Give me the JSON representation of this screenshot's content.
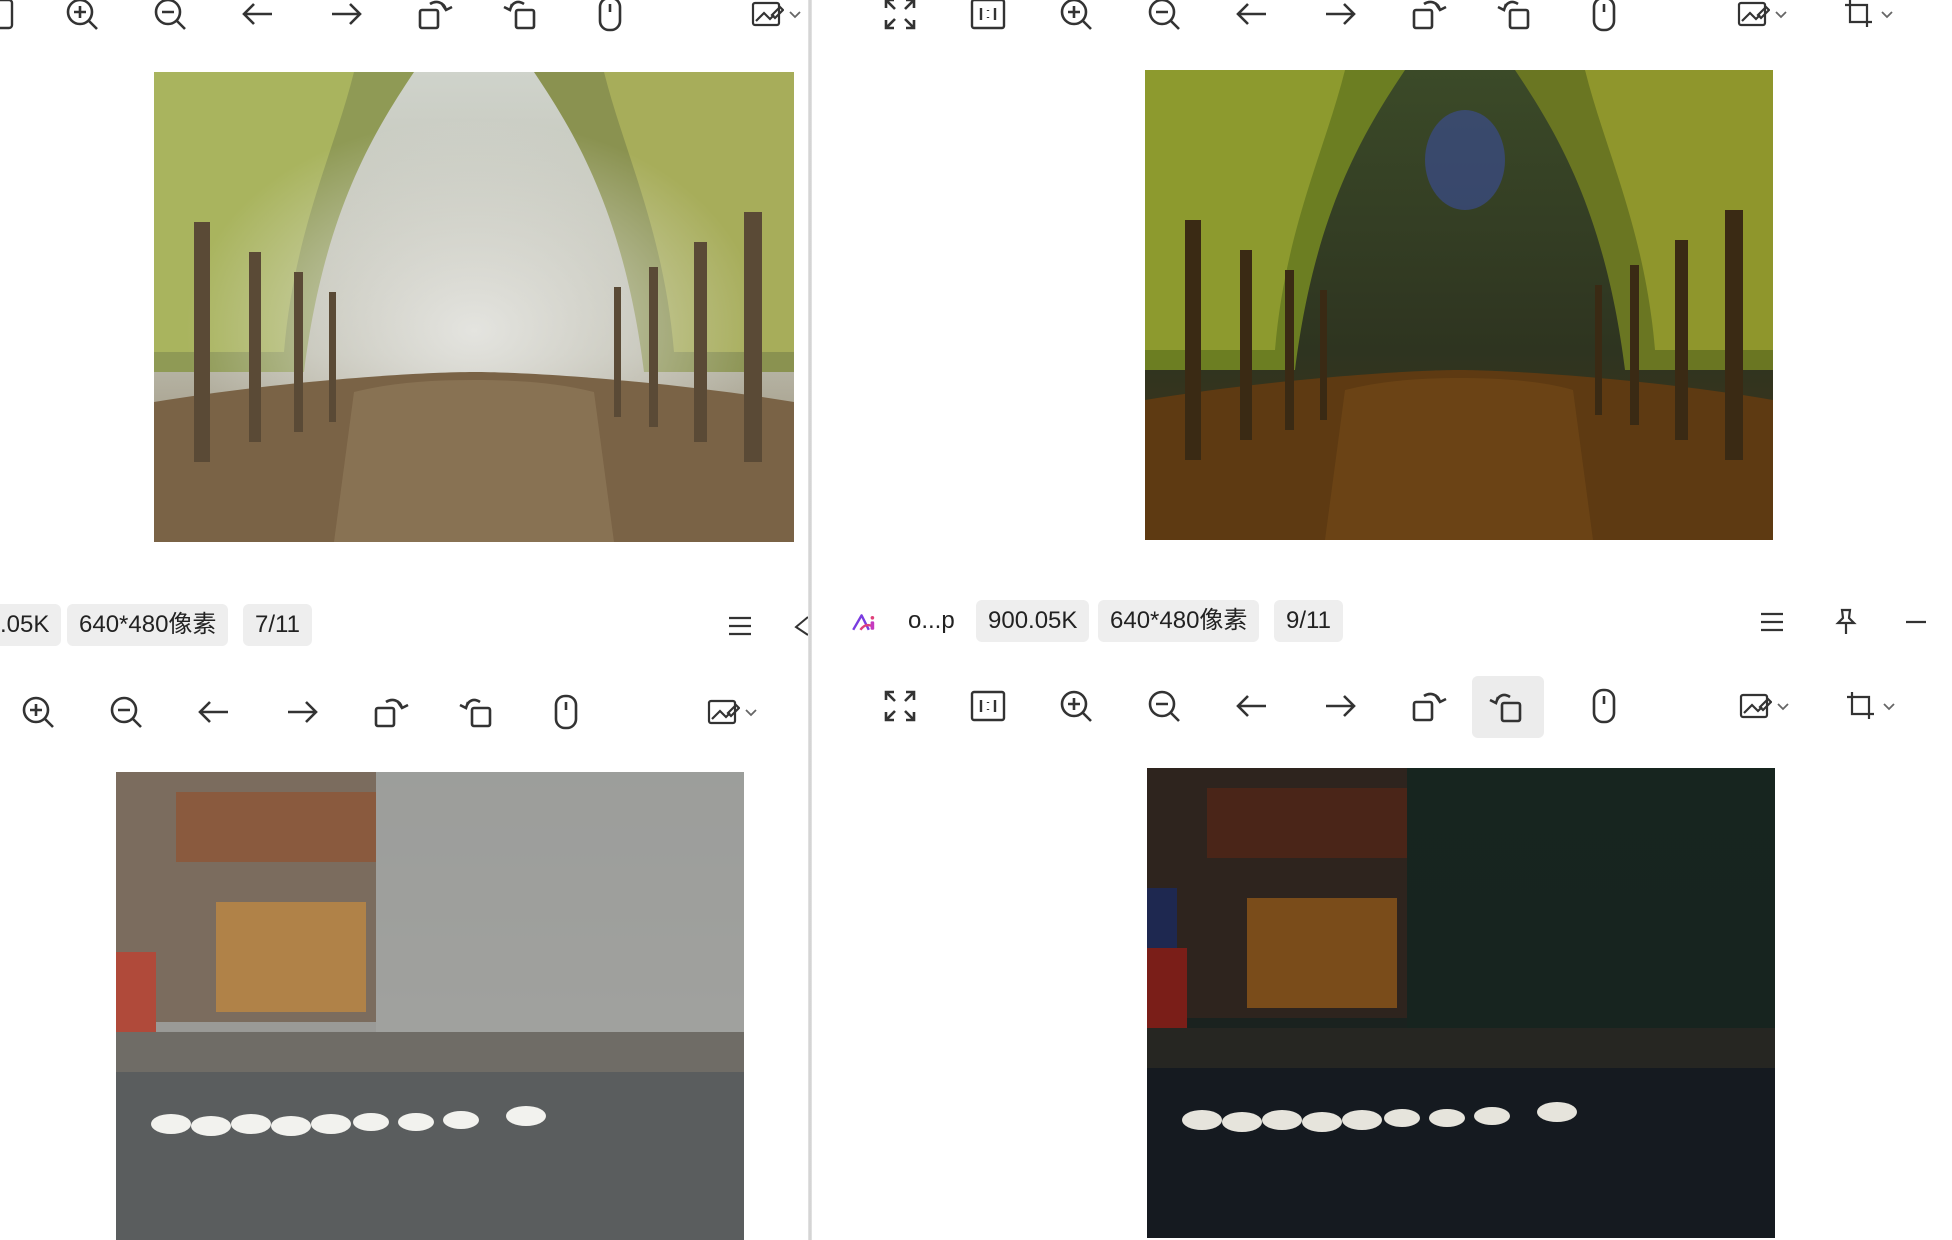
{
  "app": {
    "name_truncated": "o...p"
  },
  "windows": {
    "top_left": {
      "image_desc": "misty tree-lined road"
    },
    "top_right": {
      "image_desc": "dehazed tree-lined road"
    },
    "bottom_left": {
      "file_size": ".05K",
      "resolution": "640*480像素",
      "index": "7/11"
    },
    "bottom_right": {
      "file_size": "900.05K",
      "resolution": "640*480像素",
      "index": "9/11"
    }
  },
  "colors": {
    "toolbar_icon": "#333333",
    "pill_bg": "#eeeeee",
    "active_tool_bg": "#ececec",
    "logo_pink": "#e0407a",
    "logo_purple": "#7a3ce0"
  }
}
